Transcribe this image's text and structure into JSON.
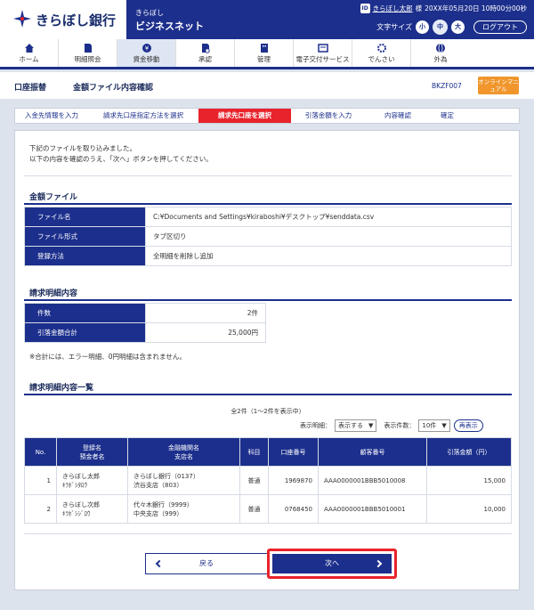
{
  "header": {
    "bank_name": "きらぼし銀行",
    "biz_small": "きらぼし",
    "biz_big": "ビジネスネット",
    "user_name": "きらぼし太郎",
    "user_honorific": "様",
    "datetime": "20XX年05月20日 10時00分00秒",
    "font_size_label": "文字サイズ",
    "font_small": "小",
    "font_medium": "中",
    "font_large": "大",
    "logout": "ログアウト"
  },
  "nav": [
    {
      "label": "ホーム",
      "icon": "home-icon"
    },
    {
      "label": "明細照会",
      "icon": "document-icon"
    },
    {
      "label": "資金移動",
      "icon": "yen-icon"
    },
    {
      "label": "承認",
      "icon": "approval-icon"
    },
    {
      "label": "管理",
      "icon": "building-icon"
    },
    {
      "label": "電子交付サービス",
      "icon": "doc-box-icon"
    },
    {
      "label": "でんさい",
      "icon": "gear-icon"
    },
    {
      "label": "外為",
      "icon": "globe-icon"
    }
  ],
  "title": {
    "category": "口座振替",
    "main": "金額ファイル内容確認",
    "screen_id": "BKZF007",
    "manual": "オンラインマニュアル"
  },
  "steps": [
    "入金先情報を入力",
    "請求先口座指定方法を選択",
    "請求先口座を選択",
    "引落金額を入力",
    "内容確認",
    "確定"
  ],
  "intro": {
    "line1": "下記のファイルを取り込みました。",
    "line2": "以下の内容を確認のうえ、「次へ」ボタンを押してください。"
  },
  "amount_file": {
    "title": "金額ファイル",
    "rows": [
      {
        "label": "ファイル名",
        "value": "C:¥Documents and Settings¥kiraboshi¥デスクトップ¥senddata.csv"
      },
      {
        "label": "ファイル形式",
        "value": "タブ区切り"
      },
      {
        "label": "登録方法",
        "value": "全明細を削除し追加"
      }
    ]
  },
  "billing_summary": {
    "title": "請求明細内容",
    "rows": [
      {
        "label": "件数",
        "value": "2件"
      },
      {
        "label": "引落金額合計",
        "value": "25,000円"
      }
    ],
    "note": "※合計には、エラー明細、0円明細は含まれません。"
  },
  "billing_list": {
    "title": "請求明細内容一覧",
    "count_text": "全2件（1～2件を表示中）",
    "filter_label": "表示明細：",
    "filter_value": "表示する",
    "per_page_label": "表示件数：",
    "per_page_value": "10件",
    "redisplay": "再表示",
    "headers": [
      "No.",
      "登録名",
      "預金者名",
      "金融機関名",
      "支店名",
      "科目",
      "口座番号",
      "顧客番号",
      "引落金額（円）"
    ],
    "rows": [
      {
        "no": "1",
        "reg_name": "きらぼし太郎",
        "kana": "ｷﾗﾎﾞｼﾀﾛｳ",
        "bank": "きらぼし銀行（0137）",
        "branch": "渋谷支店（803）",
        "type": "普通",
        "account": "1969870",
        "customer": "AAA0000001BBB5010008",
        "amount": "15,000"
      },
      {
        "no": "2",
        "reg_name": "きらぼし次郎",
        "kana": "ｷﾗﾎﾞｼｼﾞﾛｳ",
        "bank": "代々木銀行（9999）",
        "branch": "中央支店（999）",
        "type": "普通",
        "account": "0768450",
        "customer": "AAA0000001BBB5010001",
        "amount": "10,000"
      }
    ]
  },
  "buttons": {
    "back": "戻る",
    "next": "次へ"
  },
  "colors": {
    "primary": "#1c2f8c",
    "accent": "#e8232c",
    "manual": "#f0962c"
  }
}
